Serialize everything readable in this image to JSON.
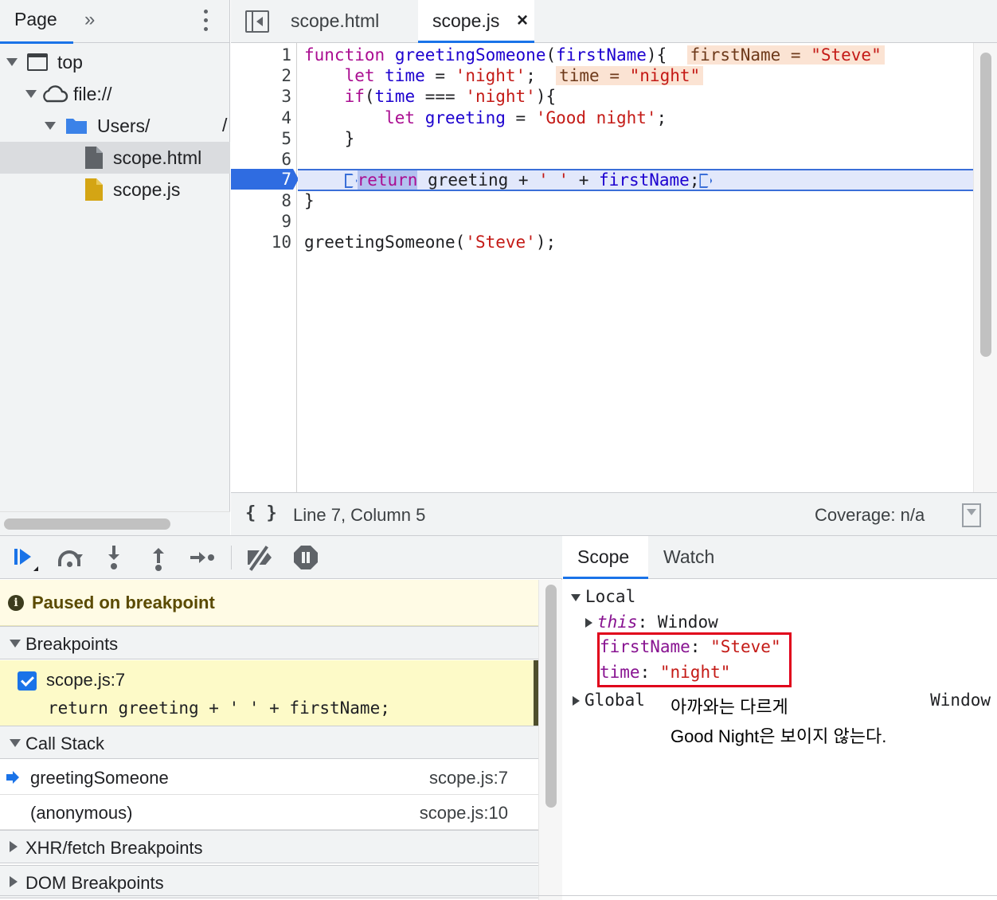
{
  "navigator": {
    "tab_label": "Page",
    "more_glyph": "»",
    "tree": [
      {
        "label": "top",
        "icon": "frame-icon"
      },
      {
        "label": "file://",
        "icon": "cloud-icon"
      },
      {
        "label": "Users/",
        "icon": "folder-icon",
        "trailing": "/"
      },
      {
        "label": "scope.html",
        "icon": "file-icon",
        "selected": true
      },
      {
        "label": "scope.js",
        "icon": "js-file-icon"
      }
    ]
  },
  "editor": {
    "tabs": [
      {
        "label": "scope.html",
        "active": false
      },
      {
        "label": "scope.js",
        "active": true,
        "close_glyph": "×"
      }
    ],
    "line_numbers": [
      "1",
      "2",
      "3",
      "4",
      "5",
      "6",
      "7",
      "8",
      "9",
      "10"
    ],
    "current_line": "7",
    "lines": [
      {
        "n": 1,
        "t1": "function",
        "t2": " ",
        "t3": "greetingSomeone",
        "t4": "(",
        "t5": "firstName",
        "t6": "){  ",
        "inline_name": "firstName = ",
        "inline_value": "\"Steve\""
      },
      {
        "n": 2,
        "t1": "    let ",
        "t2": "time",
        "t3": " = ",
        "t4": "'night'",
        "t5": ";  ",
        "inline_name": "time = ",
        "inline_value": "\"night\""
      },
      {
        "n": 3,
        "t1": "    if",
        "t2": "(",
        "t3": "time",
        "t4": " === ",
        "t5": "'night'",
        "t6": "){"
      },
      {
        "n": 4,
        "t1": "        let ",
        "t2": "greeting",
        "t3": " = ",
        "t4": "'Good night'",
        "t5": ";"
      },
      {
        "n": 5,
        "text": "    }"
      },
      {
        "n": 6,
        "text": ""
      },
      {
        "n": 7,
        "t1": "return",
        "t2": " greeting + ",
        "t3": "' '",
        "t4": " + ",
        "t5": "firstName",
        "t6": ";"
      },
      {
        "n": 8,
        "text": "}"
      },
      {
        "n": 9,
        "text": ""
      },
      {
        "n": 10,
        "t1": "greetingSomeone(",
        "t2": "'Steve'",
        "t3": ");"
      }
    ],
    "status": {
      "pretty_print": "{ }",
      "cursor": "Line 7, Column 5",
      "coverage": "Coverage: n/a"
    }
  },
  "debugger": {
    "paused_message": "Paused on breakpoint",
    "sections": {
      "breakpoints": "Breakpoints",
      "call_stack": "Call Stack",
      "xhr": "XHR/fetch Breakpoints",
      "dom": "DOM Breakpoints"
    },
    "breakpoint": {
      "location": "scope.js:7",
      "code": "return greeting + ' ' + firstName;",
      "checked": true
    },
    "call_stack": [
      {
        "name": "greetingSomeone",
        "location": "scope.js:7",
        "current": true
      },
      {
        "name": "(anonymous)",
        "location": "scope.js:10",
        "current": false
      }
    ]
  },
  "scope": {
    "tabs": [
      "Scope",
      "Watch"
    ],
    "local_label": "Local",
    "this_key": "this",
    "this_value": "Window",
    "vars": [
      {
        "key": "firstName",
        "value": "\"Steve\""
      },
      {
        "key": "time",
        "value": "\"night\""
      }
    ],
    "global_label": "Global",
    "global_value": "Window",
    "annotation_line1": "아까와는 다르게",
    "annotation_line2": "Good Night은 보이지 않는다."
  },
  "colors": {
    "accent": "#1a73e8",
    "breakpoint_marker": "#2f6ce1",
    "highlight_box": "#e0001b",
    "paused_banner": "#fffbe5"
  }
}
